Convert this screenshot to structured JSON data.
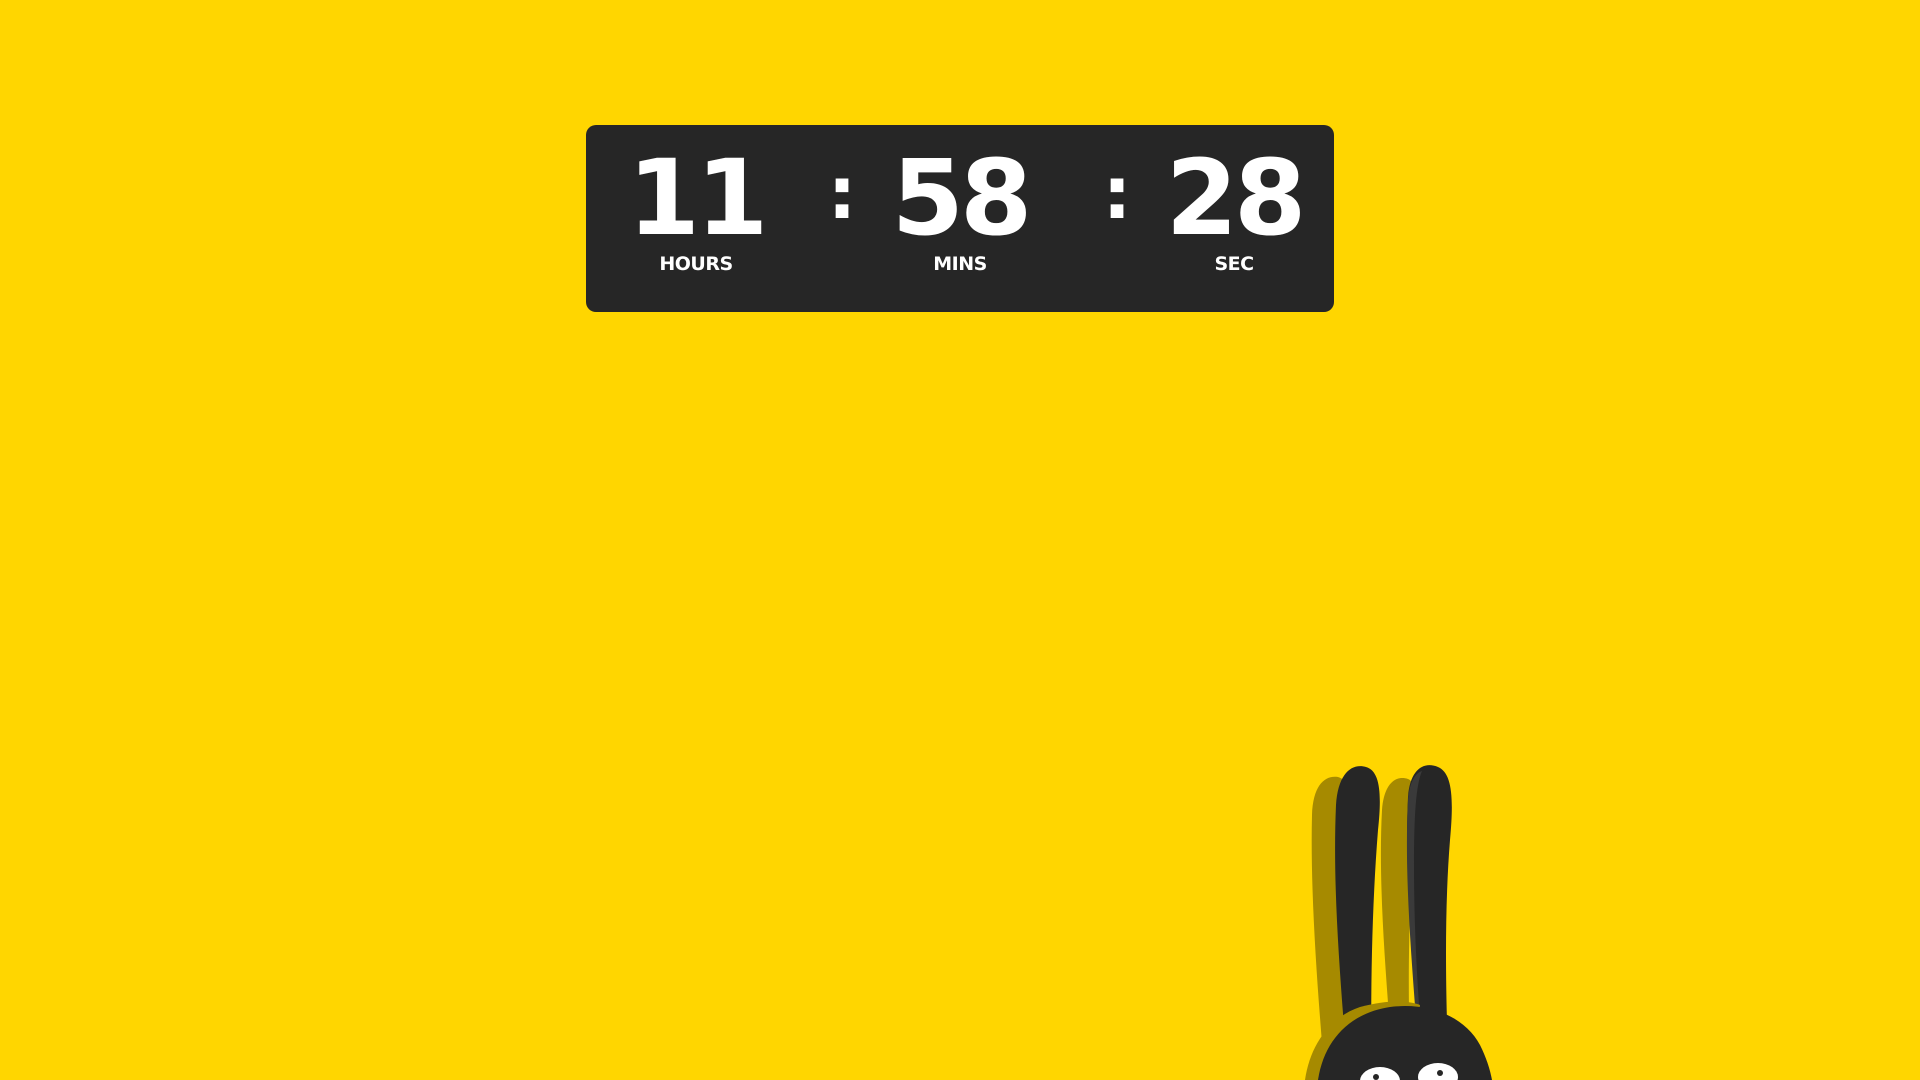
{
  "background_color": "#FFD600",
  "panel_color": "#262626",
  "countdown": {
    "hours": {
      "value": "11",
      "label": "HOURS"
    },
    "minutes": {
      "value": "58",
      "label": "MINS"
    },
    "seconds": {
      "value": "28",
      "label": "SEC"
    },
    "separator": ":"
  },
  "illustration": "black-bunny-mascot"
}
